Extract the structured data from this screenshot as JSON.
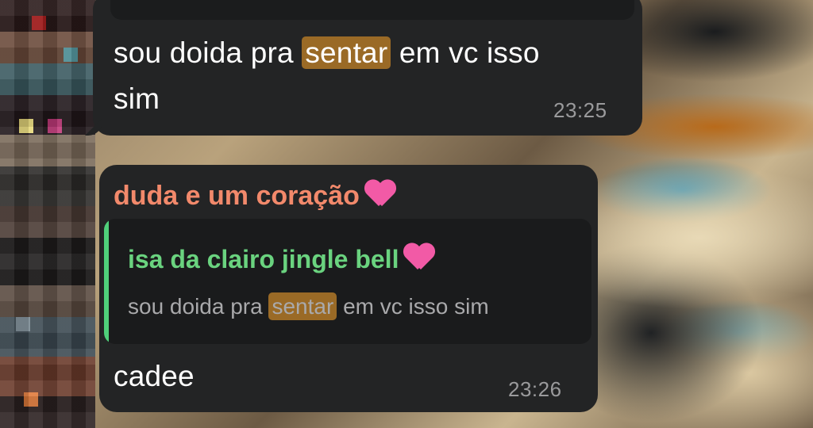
{
  "messages": [
    {
      "text_before": "sou doida pra ",
      "highlight": "sentar",
      "text_after": " em vc isso",
      "text_line2": "sim",
      "time": "23:25"
    },
    {
      "sender": "duda e um coração",
      "sender_emoji": "pink-heart",
      "reply": {
        "name": "isa da clairo jingle bell",
        "name_emoji": "pink-heart",
        "text_before": "sou doida pra ",
        "highlight": "sentar",
        "text_after": " em vc isso sim"
      },
      "text": "cadee",
      "time": "23:26"
    }
  ],
  "colors": {
    "bubble": "#232425",
    "sender_name": "#f2896b",
    "reply_name": "#6ad37f",
    "reply_bar": "#4fcf7a",
    "highlight": "#9a6a26",
    "timestamp": "#9a9a9c"
  }
}
